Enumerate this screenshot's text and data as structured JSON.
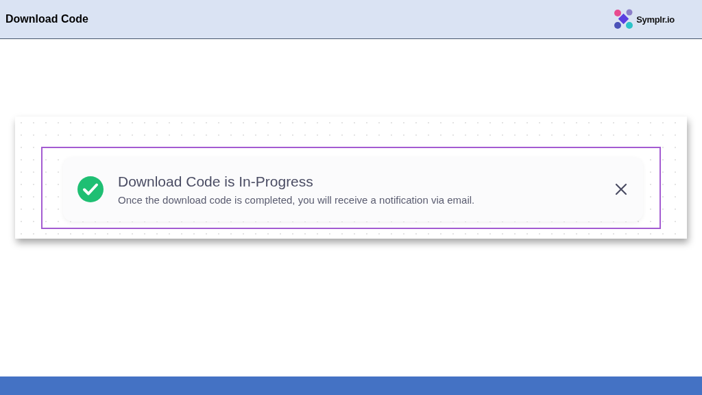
{
  "header": {
    "title": "Download Code",
    "logo_text": "Symplr.io"
  },
  "toast": {
    "kind": "success",
    "title": "Download Code is In-Progress",
    "message": "Once the download code is completed, you will receive a notification via email."
  }
}
